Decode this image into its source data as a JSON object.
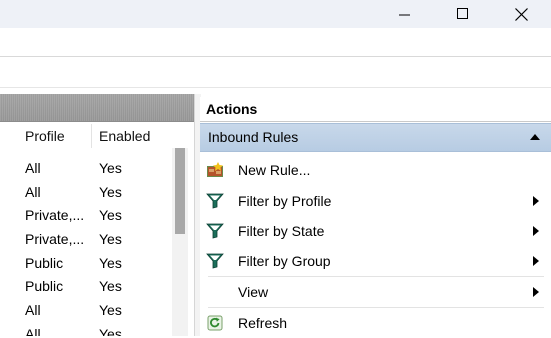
{
  "window": {
    "minimize_icon": "minimize-icon",
    "maximize_icon": "maximize-icon",
    "close_icon": "close-icon"
  },
  "rules_table": {
    "columns": [
      "Profile",
      "Enabled"
    ],
    "rows": [
      {
        "profile": "All",
        "enabled": "Yes"
      },
      {
        "profile": "All",
        "enabled": "Yes"
      },
      {
        "profile": "Private,...",
        "enabled": "Yes"
      },
      {
        "profile": "Private,...",
        "enabled": "Yes"
      },
      {
        "profile": "Public",
        "enabled": "Yes"
      },
      {
        "profile": "Public",
        "enabled": "Yes"
      },
      {
        "profile": "All",
        "enabled": "Yes"
      },
      {
        "profile": "All",
        "enabled": "Yes"
      }
    ]
  },
  "actions": {
    "title": "Actions",
    "section": "Inbound Rules",
    "items": [
      {
        "label": "New Rule...",
        "icon": "new-rule-icon"
      },
      {
        "label": "Filter by Profile",
        "icon": "filter-icon",
        "submenu": true
      },
      {
        "label": "Filter by State",
        "icon": "filter-icon",
        "submenu": true
      },
      {
        "label": "Filter by Group",
        "icon": "filter-icon",
        "submenu": true
      },
      {
        "label": "View",
        "icon": "",
        "submenu": true
      },
      {
        "label": "Refresh",
        "icon": "refresh-icon"
      }
    ]
  },
  "colors": {
    "section_header": "#c0d3e8",
    "pane_header": "#a0a0a0",
    "filter_icon": "#1b6e5a"
  }
}
